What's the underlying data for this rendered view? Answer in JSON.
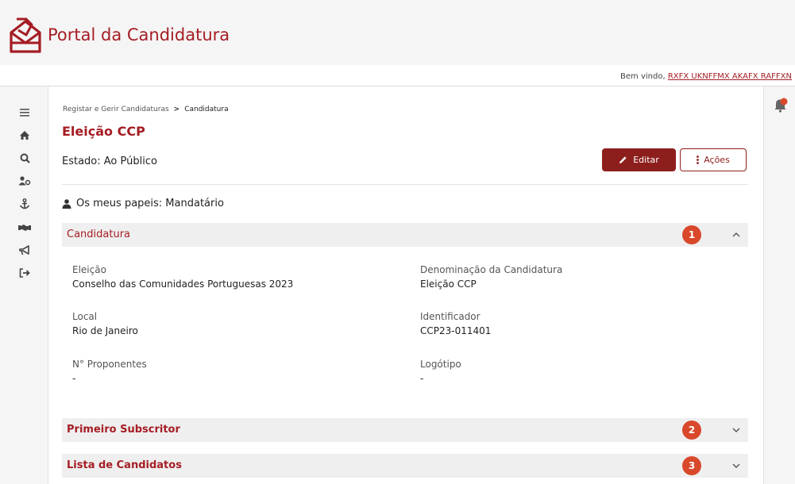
{
  "app": {
    "title": "Portal da Candidatura"
  },
  "welcome": {
    "text": "Bem vindo, ",
    "user": "RXFX UKNFFMX AKAFX RAFFXN"
  },
  "sidebar": {
    "items": [
      {
        "icon": "menu-icon"
      },
      {
        "icon": "home-icon"
      },
      {
        "icon": "search-icon"
      },
      {
        "icon": "users-icon"
      },
      {
        "icon": "anchor-icon"
      },
      {
        "icon": "handshake-icon"
      },
      {
        "icon": "megaphone-icon"
      },
      {
        "icon": "logout-icon"
      }
    ]
  },
  "notifications": {
    "icon": "bell-icon"
  },
  "breadcrumb": {
    "parent": "Registar e Gerir Candidaturas",
    "separator": ">",
    "current": "Candidatura"
  },
  "page": {
    "title": "Eleição CCP",
    "status": "Estado: Ao Público",
    "roles": "Os meus papeis: Mandatário"
  },
  "buttons": {
    "edit": "Editar",
    "actions": "Ações"
  },
  "sections": [
    {
      "title": "Candidatura",
      "badge": "1",
      "expanded": true
    },
    {
      "title": "Primeiro Subscritor",
      "badge": "2",
      "expanded": false
    },
    {
      "title": "Lista de Candidatos",
      "badge": "3",
      "expanded": false
    }
  ],
  "candidatura": {
    "eleicao_label": "Eleição",
    "eleicao_value": "Conselho das Comunidades Portuguesas 2023",
    "denominacao_label": "Denominação da Candidatura",
    "denominacao_value": "Eleição CCP",
    "local_label": "Local",
    "local_value": "Rio de Janeiro",
    "identificador_label": "Identificador",
    "identificador_value": "CCP23-011401",
    "proponentes_label": "N° Proponentes",
    "proponentes_value": "-",
    "logotipo_label": "Logótipo",
    "logotipo_value": "-"
  },
  "colors": {
    "brand": "#a51d24",
    "button_primary": "#8c1f1c",
    "badge": "#d9482b",
    "section_bg": "#efefef"
  }
}
